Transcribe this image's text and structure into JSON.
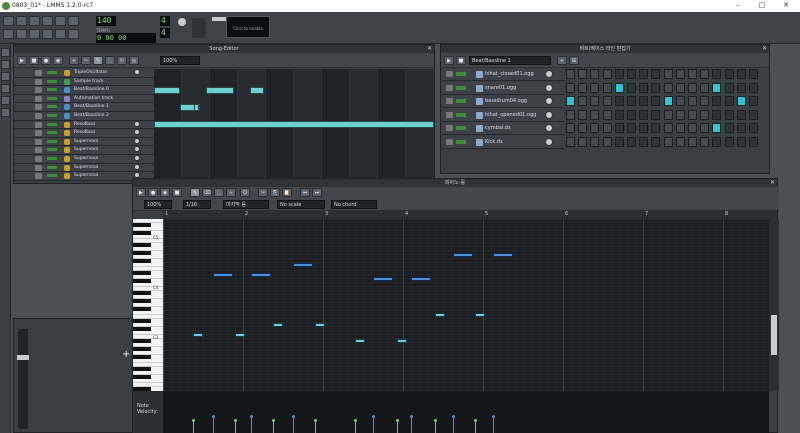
{
  "window": {
    "title": "0803_01* - LMMS 1.2.0-rc7",
    "controls": [
      "–",
      "□",
      "✕"
    ]
  },
  "toolbar": {
    "tempo": "140",
    "time": "0 00 00",
    "time_labels": [
      "MIN",
      "SEC",
      "MSEC"
    ],
    "timesig_top": "4",
    "timesig_bottom": "4",
    "tempo_label": "TEMPO",
    "timesig_label": "TIME SIG",
    "scope_label": "Click to enable"
  },
  "song_editor": {
    "title": "Song-Editor",
    "zoom": "100%",
    "tracks": [
      {
        "name": "TripleOscillator",
        "type": "instrument"
      },
      {
        "name": "Sample track",
        "type": "sample"
      },
      {
        "name": "Beat/Bassline 0",
        "type": "bb"
      },
      {
        "name": "Automation track",
        "type": "automation"
      },
      {
        "name": "Beat/Bassline 1",
        "type": "bb"
      },
      {
        "name": "Beat/Bassline 2",
        "type": "bb"
      },
      {
        "name": "ResoBass",
        "type": "instrument"
      },
      {
        "name": "ResoBass",
        "type": "instrument"
      },
      {
        "name": "Supernova",
        "type": "instrument"
      },
      {
        "name": "Supernova",
        "type": "instrument"
      },
      {
        "name": "Supernova",
        "type": "instrument"
      },
      {
        "name": "Supernova",
        "type": "instrument"
      },
      {
        "name": "Supernova",
        "type": "instrument"
      }
    ]
  },
  "bb_editor": {
    "title": "비트/베이스 라인 편집기",
    "selected": "Beat/Bassline 1",
    "rows": [
      {
        "name": "hihat_closed01.ogg",
        "steps": [
          0,
          0,
          0,
          0,
          0,
          0,
          0,
          0,
          0,
          0,
          0,
          0,
          0,
          0,
          0,
          0
        ]
      },
      {
        "name": "snare01.ogg",
        "steps": [
          0,
          0,
          0,
          0,
          1,
          0,
          0,
          0,
          0,
          0,
          0,
          0,
          1,
          0,
          0,
          0
        ]
      },
      {
        "name": "bassdrum04.ogg",
        "steps": [
          1,
          0,
          0,
          0,
          0,
          0,
          0,
          0,
          1,
          0,
          0,
          0,
          0,
          0,
          1,
          0
        ]
      },
      {
        "name": "hihat_opened01.ogg",
        "steps": [
          0,
          0,
          0,
          0,
          0,
          0,
          0,
          0,
          0,
          0,
          0,
          0,
          0,
          0,
          0,
          0
        ]
      },
      {
        "name": "cymbal.ds",
        "steps": [
          0,
          0,
          0,
          0,
          0,
          0,
          0,
          0,
          0,
          0,
          0,
          0,
          1,
          0,
          0,
          0
        ]
      },
      {
        "name": "Kick.ds",
        "steps": [
          0,
          0,
          0,
          0,
          0,
          0,
          0,
          0,
          0,
          0,
          0,
          0,
          0,
          0,
          0,
          0
        ]
      }
    ]
  },
  "piano_roll": {
    "title": "피아노-롤",
    "zoom": "100%",
    "quantize": "1/16",
    "note_len": "마지막 음",
    "scale": "No scale",
    "chord": "No chord",
    "octave_labels": [
      "C5",
      "C4",
      "C3"
    ],
    "velocity_label": "Note\nVelocity:",
    "ruler": [
      "1",
      "2",
      "3",
      "4",
      "5",
      "6",
      "7",
      "8"
    ]
  },
  "colors": {
    "accent": "#6bd0cf",
    "note": "#4e8fd6",
    "bb_active": "#33c4d4"
  },
  "icons": [
    "play-icon",
    "stop-icon",
    "record-icon",
    "pencil-icon",
    "eraser-icon",
    "close-icon",
    "detach-icon"
  ]
}
